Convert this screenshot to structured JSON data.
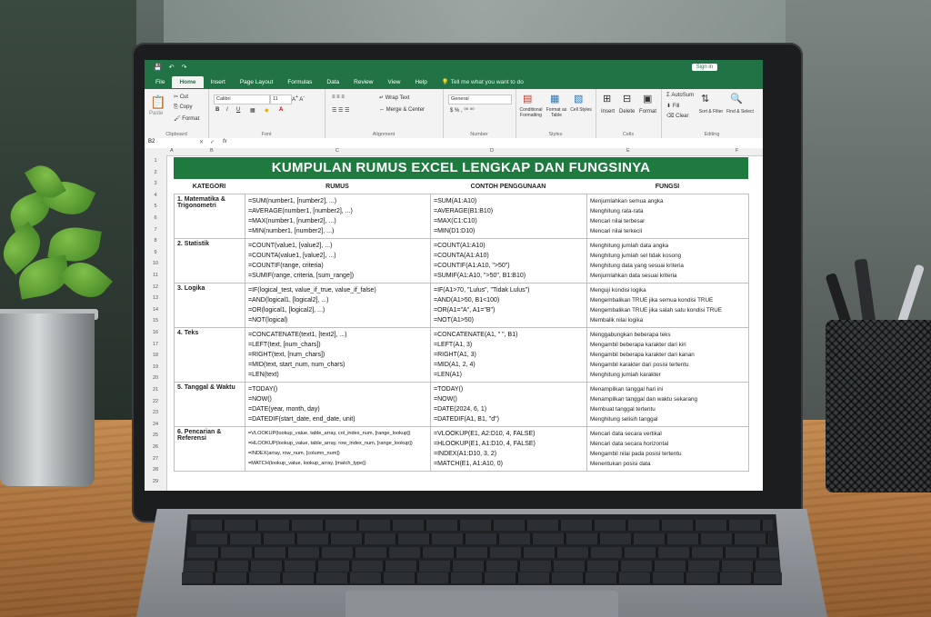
{
  "excel": {
    "quick_access": [
      "💾",
      "↶",
      "↷"
    ],
    "sign_in": "Sign in",
    "tabs": [
      "File",
      "Home",
      "Insert",
      "Page Layout",
      "Formulas",
      "Data",
      "Review",
      "View",
      "Help"
    ],
    "tell_me": "Tell me what you want to do",
    "ribbon": {
      "clipboard": {
        "paste": "Paste",
        "cut": "Cut",
        "copy": "Copy",
        "format_painter": "Format",
        "label": "Clipboard"
      },
      "font": {
        "name": "Calibri",
        "size": "11",
        "label": "Font"
      },
      "alignment": {
        "wrap": "Wrap Text",
        "merge": "Merge & Center",
        "label": "Alignment"
      },
      "number": {
        "format": "General",
        "label": "Number"
      },
      "styles": {
        "conditional": "Conditional Formatting",
        "format_table": "Format as Table",
        "cell_styles": "Cell Styles",
        "label": "Styles"
      },
      "cells": {
        "insert": "Insert",
        "delete": "Delete",
        "format": "Format",
        "label": "Cells"
      },
      "editing": {
        "autosum": "AutoSum",
        "fill": "Fill",
        "clear": "Clear",
        "sort": "Sort & Filter",
        "find": "Find & Select",
        "label": "Editing"
      }
    },
    "name_box": "B2",
    "fx": "fx",
    "columns": [
      "A",
      "B",
      "C",
      "D",
      "E",
      "F"
    ],
    "rows": [
      "1",
      "2",
      "3",
      "4",
      "5",
      "6",
      "7",
      "8",
      "9",
      "10",
      "11",
      "12",
      "13",
      "14",
      "15",
      "16",
      "17",
      "18",
      "19",
      "20",
      "21",
      "22",
      "23",
      "24",
      "25",
      "26",
      "27",
      "28",
      "29"
    ]
  },
  "sheet": {
    "title": "KUMPULAN RUMUS EXCEL LENGKAP DAN FUNGSINYA",
    "headers": {
      "kategori": "KATEGORI",
      "rumus": "RUMUS",
      "contoh": "CONTOH PENGGUNAAN",
      "fungsi": "FUNGSI"
    },
    "groups": [
      {
        "kategori": "1. Matematika & Trigonometri",
        "rumus": [
          "=SUM(number1, [number2], ...)",
          "=AVERAGE(number1, [number2], ...)",
          "=MAX(number1, [number2], ...)",
          "=MIN(number1, [number2], ...)"
        ],
        "contoh": [
          "=SUM(A1:A10)",
          "=AVERAGE(B1:B10)",
          "=MAX(C1:C10)",
          "=MIN(D1:D10)"
        ],
        "fungsi": [
          "Menjumlahkan semua angka",
          "Menghitung rata-rata",
          "Mencari nilai terbesar",
          "Mencari nilai terkecil"
        ]
      },
      {
        "kategori": "2. Statistik",
        "rumus": [
          "=COUNT(value1, [value2], ...)",
          "=COUNTA(value1, [value2], ...)",
          "=COUNTIF(range, criteria)",
          "=SUMIF(range, criteria, [sum_range])"
        ],
        "contoh": [
          "=COUNT(A1:A10)",
          "=COUNTA(A1:A10)",
          "=COUNTIF(A1:A10, \">50\")",
          "=SUMIF(A1:A10, \">50\", B1:B10)"
        ],
        "fungsi": [
          "Menghitung jumlah data angka",
          "Menghitung jumlah sel tidak kosong",
          "Menghitung data yang sesuai kriteria",
          "Menjumlahkan data sesuai kriteria"
        ]
      },
      {
        "kategori": "3. Logika",
        "rumus": [
          "=IF(logical_test, value_if_true, value_if_false)",
          "=AND(logical1, [logical2], ...)",
          "=OR(logical1, [logical2], ...)",
          "=NOT(logical)"
        ],
        "contoh": [
          "=IF(A1>70, \"Lulus\", \"Tidak Lulus\")",
          "=AND(A1>50, B1<100)",
          "=OR(A1=\"A\", A1=\"B\")",
          "=NOT(A1>50)"
        ],
        "fungsi": [
          "Menguji kondisi logika",
          "Mengembalikan TRUE jika semua kondisi TRUE",
          "Mengembalikan TRUE jika salah satu kondisi TRUE",
          "Membalik nilai logika"
        ]
      },
      {
        "kategori": "4. Teks",
        "rumus": [
          "=CONCATENATE(text1, [text2], ...)",
          "=LEFT(text, [num_chars])",
          "=RIGHT(text, [num_chars])",
          "=MID(text, start_num, num_chars)",
          "=LEN(text)"
        ],
        "contoh": [
          "=CONCATENATE(A1, \" \", B1)",
          "=LEFT(A1, 3)",
          "=RIGHT(A1, 3)",
          "=MID(A1, 2, 4)",
          "=LEN(A1)"
        ],
        "fungsi": [
          "Menggabungkan beberapa teks",
          "Mengambil beberapa karakter dari kiri",
          "Mengambil beberapa karakter dari kanan",
          "Mengambil karakter dari posisi tertentu",
          "Menghitung jumlah karakter"
        ]
      },
      {
        "kategori": "5. Tanggal & Waktu",
        "rumus": [
          "=TODAY()",
          "=NOW()",
          "=DATE(year, month, day)",
          "=DATEDIF(start_date, end_date, unit)"
        ],
        "contoh": [
          "=TODAY()",
          "=NOW()",
          "=DATE(2024, 6, 1)",
          "=DATEDIF(A1, B1, \"d\")"
        ],
        "fungsi": [
          "Menampilkan tanggal hari ini",
          "Menampilkan tanggal dan waktu sekarang",
          "Membuat tanggal tertentu",
          "Menghitung selisih tanggal"
        ]
      },
      {
        "kategori": "6. Pencarian & Referensi",
        "rumus": [
          "=VLOOKUP(lookup_value, table_array, col_index_num, [range_lookup])",
          "=HLOOKUP(lookup_value, table_array, row_index_num, [range_lookup])",
          "=INDEX(array, row_num, [column_num])",
          "=MATCH(lookup_value, lookup_array, [match_type])"
        ],
        "contoh": [
          "=VLOOKUP(E1, A2:D10, 4, FALSE)",
          "=HLOOKUP(E1, A1:D10, 4, FALSE)",
          "=INDEX(A1:D10, 3, 2)",
          "=MATCH(E1, A1:A10, 0)"
        ],
        "fungsi": [
          "Mencari data secara vertikal",
          "Mencari data secara horizontal",
          "Mengambil nilai pada posisi tertentu",
          "Menentukan posisi data"
        ]
      }
    ]
  }
}
